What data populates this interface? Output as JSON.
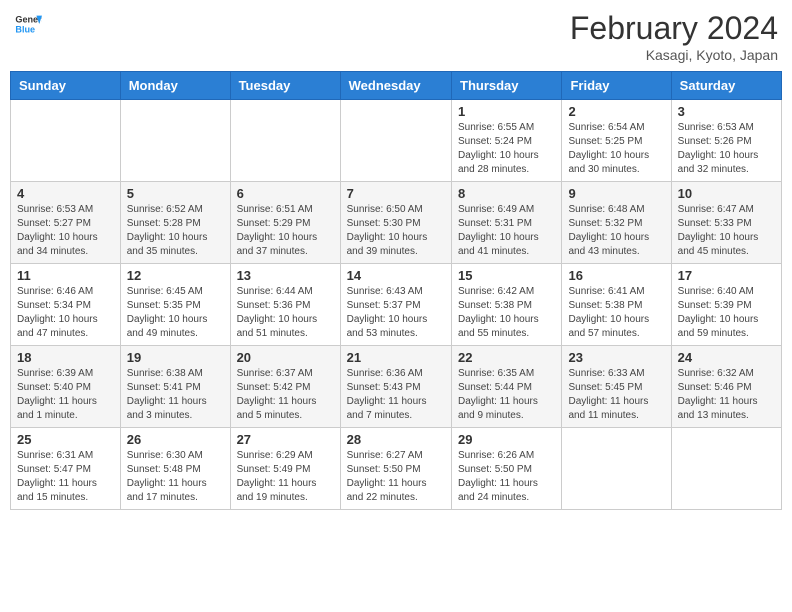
{
  "header": {
    "logo_line1": "General",
    "logo_line2": "Blue",
    "month_year": "February 2024",
    "location": "Kasagi, Kyoto, Japan"
  },
  "weekdays": [
    "Sunday",
    "Monday",
    "Tuesday",
    "Wednesday",
    "Thursday",
    "Friday",
    "Saturday"
  ],
  "weeks": [
    [
      {
        "day": "",
        "info": ""
      },
      {
        "day": "",
        "info": ""
      },
      {
        "day": "",
        "info": ""
      },
      {
        "day": "",
        "info": ""
      },
      {
        "day": "1",
        "info": "Sunrise: 6:55 AM\nSunset: 5:24 PM\nDaylight: 10 hours\nand 28 minutes."
      },
      {
        "day": "2",
        "info": "Sunrise: 6:54 AM\nSunset: 5:25 PM\nDaylight: 10 hours\nand 30 minutes."
      },
      {
        "day": "3",
        "info": "Sunrise: 6:53 AM\nSunset: 5:26 PM\nDaylight: 10 hours\nand 32 minutes."
      }
    ],
    [
      {
        "day": "4",
        "info": "Sunrise: 6:53 AM\nSunset: 5:27 PM\nDaylight: 10 hours\nand 34 minutes."
      },
      {
        "day": "5",
        "info": "Sunrise: 6:52 AM\nSunset: 5:28 PM\nDaylight: 10 hours\nand 35 minutes."
      },
      {
        "day": "6",
        "info": "Sunrise: 6:51 AM\nSunset: 5:29 PM\nDaylight: 10 hours\nand 37 minutes."
      },
      {
        "day": "7",
        "info": "Sunrise: 6:50 AM\nSunset: 5:30 PM\nDaylight: 10 hours\nand 39 minutes."
      },
      {
        "day": "8",
        "info": "Sunrise: 6:49 AM\nSunset: 5:31 PM\nDaylight: 10 hours\nand 41 minutes."
      },
      {
        "day": "9",
        "info": "Sunrise: 6:48 AM\nSunset: 5:32 PM\nDaylight: 10 hours\nand 43 minutes."
      },
      {
        "day": "10",
        "info": "Sunrise: 6:47 AM\nSunset: 5:33 PM\nDaylight: 10 hours\nand 45 minutes."
      }
    ],
    [
      {
        "day": "11",
        "info": "Sunrise: 6:46 AM\nSunset: 5:34 PM\nDaylight: 10 hours\nand 47 minutes."
      },
      {
        "day": "12",
        "info": "Sunrise: 6:45 AM\nSunset: 5:35 PM\nDaylight: 10 hours\nand 49 minutes."
      },
      {
        "day": "13",
        "info": "Sunrise: 6:44 AM\nSunset: 5:36 PM\nDaylight: 10 hours\nand 51 minutes."
      },
      {
        "day": "14",
        "info": "Sunrise: 6:43 AM\nSunset: 5:37 PM\nDaylight: 10 hours\nand 53 minutes."
      },
      {
        "day": "15",
        "info": "Sunrise: 6:42 AM\nSunset: 5:38 PM\nDaylight: 10 hours\nand 55 minutes."
      },
      {
        "day": "16",
        "info": "Sunrise: 6:41 AM\nSunset: 5:38 PM\nDaylight: 10 hours\nand 57 minutes."
      },
      {
        "day": "17",
        "info": "Sunrise: 6:40 AM\nSunset: 5:39 PM\nDaylight: 10 hours\nand 59 minutes."
      }
    ],
    [
      {
        "day": "18",
        "info": "Sunrise: 6:39 AM\nSunset: 5:40 PM\nDaylight: 11 hours\nand 1 minute."
      },
      {
        "day": "19",
        "info": "Sunrise: 6:38 AM\nSunset: 5:41 PM\nDaylight: 11 hours\nand 3 minutes."
      },
      {
        "day": "20",
        "info": "Sunrise: 6:37 AM\nSunset: 5:42 PM\nDaylight: 11 hours\nand 5 minutes."
      },
      {
        "day": "21",
        "info": "Sunrise: 6:36 AM\nSunset: 5:43 PM\nDaylight: 11 hours\nand 7 minutes."
      },
      {
        "day": "22",
        "info": "Sunrise: 6:35 AM\nSunset: 5:44 PM\nDaylight: 11 hours\nand 9 minutes."
      },
      {
        "day": "23",
        "info": "Sunrise: 6:33 AM\nSunset: 5:45 PM\nDaylight: 11 hours\nand 11 minutes."
      },
      {
        "day": "24",
        "info": "Sunrise: 6:32 AM\nSunset: 5:46 PM\nDaylight: 11 hours\nand 13 minutes."
      }
    ],
    [
      {
        "day": "25",
        "info": "Sunrise: 6:31 AM\nSunset: 5:47 PM\nDaylight: 11 hours\nand 15 minutes."
      },
      {
        "day": "26",
        "info": "Sunrise: 6:30 AM\nSunset: 5:48 PM\nDaylight: 11 hours\nand 17 minutes."
      },
      {
        "day": "27",
        "info": "Sunrise: 6:29 AM\nSunset: 5:49 PM\nDaylight: 11 hours\nand 19 minutes."
      },
      {
        "day": "28",
        "info": "Sunrise: 6:27 AM\nSunset: 5:50 PM\nDaylight: 11 hours\nand 22 minutes."
      },
      {
        "day": "29",
        "info": "Sunrise: 6:26 AM\nSunset: 5:50 PM\nDaylight: 11 hours\nand 24 minutes."
      },
      {
        "day": "",
        "info": ""
      },
      {
        "day": "",
        "info": ""
      }
    ]
  ]
}
